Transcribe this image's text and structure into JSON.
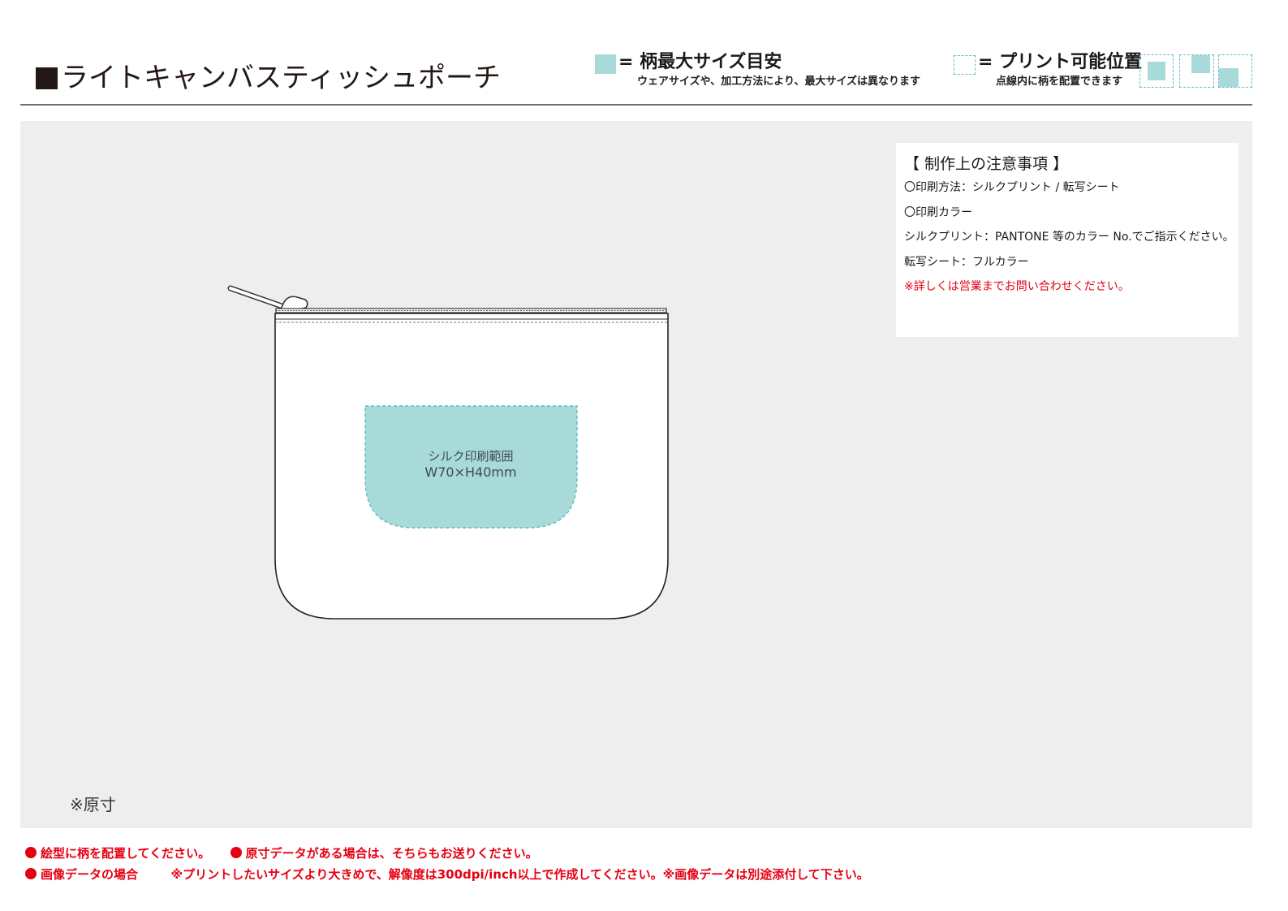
{
  "header": {
    "title": "ライトキャンバスティッシュポーチ",
    "legend_max": {
      "label": "= 柄最大サイズ目安",
      "note": "ウェアサイズや、加工方法により、最大サイズは異なります"
    },
    "legend_printable": {
      "label": "= プリント可能位置",
      "note": "点線内に柄を配置できます"
    }
  },
  "colors": {
    "print_area_fill": "#a8dad9",
    "print_area_border": "#5fbcc1",
    "workspace_bg": "#eeeeee",
    "warning_red": "#e60012"
  },
  "notes": {
    "heading": "【 制作上の注意事項 】",
    "lines": [
      "〇印刷方法：シルクプリント / 転写シート",
      "〇印刷カラー",
      "シルクプリント：PANTONE 等のカラー No.でご指示ください。",
      "転写シート：フルカラー"
    ],
    "warning": "※詳しくは営業までお問い合わせください。"
  },
  "print_area": {
    "line1": "シルク印刷範囲",
    "line2": "W70×H40mm"
  },
  "scale_note": "※原寸",
  "footer": {
    "item1": "絵型に柄を配置してください。",
    "item2": "原寸データがある場合は、そちらもお送りください。",
    "item3": "画像データの場合",
    "item3_detail": "※プリントしたいサイズより大きめで、解像度は300dpi/inch以上で作成してください。※画像データは別途添付して下さい。"
  }
}
